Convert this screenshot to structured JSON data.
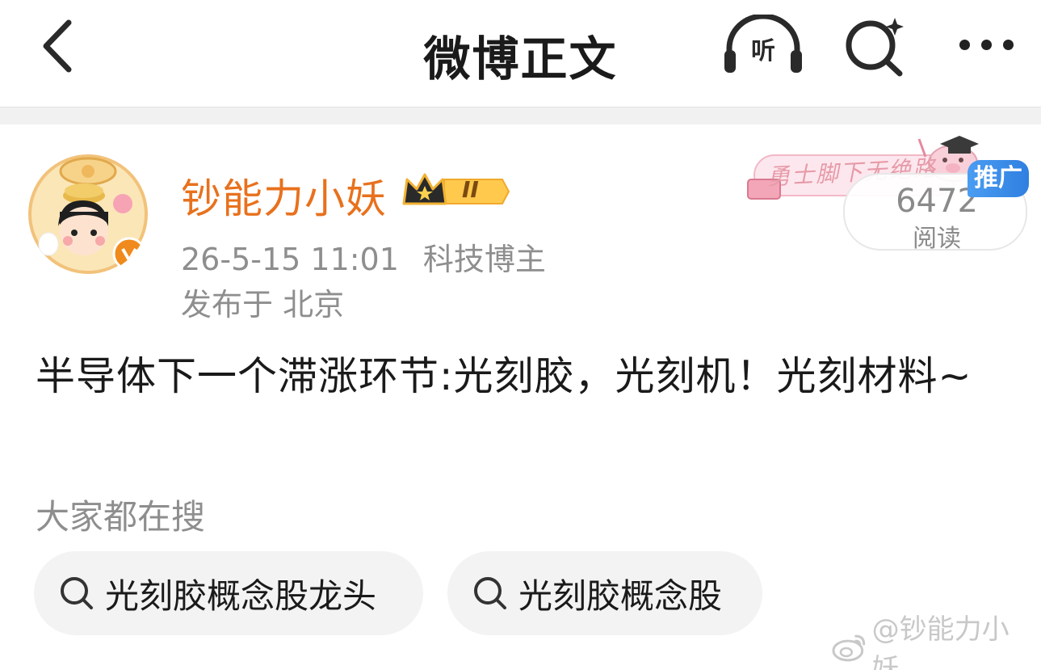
{
  "header": {
    "title": "微博正文",
    "listen_label": "听",
    "back_icon": "chevron-left-icon",
    "search_icon": "ai-search-icon",
    "more_icon": "more-dots-icon"
  },
  "author": {
    "name": "钞能力小妖",
    "level_badge": "II",
    "timestamp": "26-5-15 11:01",
    "category": "科技博主",
    "location": "发布于 北京",
    "verified": true,
    "name_color": "#e8711d"
  },
  "banner": {
    "text": "勇士脚下无绝路",
    "read_count": "6472",
    "read_label": "阅读",
    "promo_label": "推广",
    "promo_color": "#3a8ee8"
  },
  "post": {
    "text": "半导体下一个滞涨环节:光刻胶，光刻机！光刻材料~"
  },
  "suggestions": {
    "label": "大家都在搜",
    "items": [
      {
        "text": "光刻胶概念股龙头"
      },
      {
        "text": "光刻胶概念股"
      }
    ]
  },
  "watermark": {
    "text": "@钞能力小妖"
  }
}
